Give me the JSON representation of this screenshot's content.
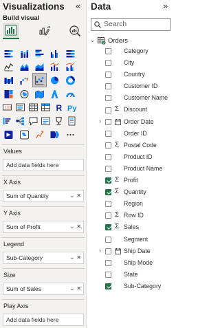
{
  "visualizations": {
    "title": "Visualizations",
    "collapse_glyph": "«",
    "build_label": "Build visual",
    "modes": [
      {
        "icon": "build-visual-icon",
        "active": true
      },
      {
        "icon": "format-visual-icon",
        "active": false
      },
      {
        "icon": "analytics-icon",
        "active": false
      }
    ],
    "gallery": [
      [
        "stacked-bar-chart-icon",
        "stacked-column-chart-icon",
        "clustered-bar-chart-icon",
        "clustered-column-chart-icon",
        "100-stacked-bar-chart-icon"
      ],
      [
        "line-chart-icon",
        "area-chart-icon",
        "stacked-area-chart-icon",
        "line-and-column-chart-icon",
        "line-and-clustered-column-chart-icon"
      ],
      [
        "ribbon-chart-icon",
        "waterfall-chart-icon",
        "scatter-chart-icon",
        "pie-chart-icon",
        "donut-chart-icon"
      ],
      [
        "treemap-icon",
        "map-icon",
        "filled-map-icon",
        "azure-map-icon",
        "gauge-icon"
      ],
      [
        "card-icon",
        "multi-row-card-icon",
        "table-icon",
        "matrix-icon",
        "r-visual-icon",
        "python-visual-icon"
      ],
      [
        "key-influencers-icon",
        "decomposition-tree-icon",
        "qa-icon",
        "smart-narrative-icon",
        "goals-icon",
        "paginated-report-icon"
      ],
      [
        "power-apps-icon",
        "power-automate-icon",
        "kpi-icon",
        "slicer-icon",
        "more-visuals-icon"
      ]
    ],
    "selected_visual": "scatter-chart-icon",
    "wells": [
      {
        "label": "Values",
        "value": "",
        "placeholder": "Add data fields here"
      },
      {
        "label": "X Axis",
        "value": "Sum of Quantity",
        "placeholder": ""
      },
      {
        "label": "Y Axis",
        "value": "Sum of Profit",
        "placeholder": ""
      },
      {
        "label": "Legend",
        "value": "Sub-Category",
        "placeholder": ""
      },
      {
        "label": "Size",
        "value": "Sum of Sales",
        "placeholder": ""
      },
      {
        "label": "Play Axis",
        "value": "",
        "placeholder": "Add data fields here"
      }
    ]
  },
  "data": {
    "title": "Data",
    "collapse_glyph": "»",
    "search_placeholder": "Search",
    "table": {
      "name": "Orders",
      "fields": [
        {
          "name": "Category",
          "sigma": false,
          "date": false,
          "expandable": false,
          "checked": false
        },
        {
          "name": "City",
          "sigma": false,
          "date": false,
          "expandable": false,
          "checked": false
        },
        {
          "name": "Country",
          "sigma": false,
          "date": false,
          "expandable": false,
          "checked": false
        },
        {
          "name": "Customer ID",
          "sigma": false,
          "date": false,
          "expandable": false,
          "checked": false
        },
        {
          "name": "Customer Name",
          "sigma": false,
          "date": false,
          "expandable": false,
          "checked": false
        },
        {
          "name": "Discount",
          "sigma": true,
          "date": false,
          "expandable": false,
          "checked": false
        },
        {
          "name": "Order Date",
          "sigma": false,
          "date": true,
          "expandable": true,
          "checked": false
        },
        {
          "name": "Order ID",
          "sigma": false,
          "date": false,
          "expandable": false,
          "checked": false
        },
        {
          "name": "Postal Code",
          "sigma": true,
          "date": false,
          "expandable": false,
          "checked": false
        },
        {
          "name": "Product ID",
          "sigma": false,
          "date": false,
          "expandable": false,
          "checked": false
        },
        {
          "name": "Product Name",
          "sigma": false,
          "date": false,
          "expandable": false,
          "checked": false
        },
        {
          "name": "Profit",
          "sigma": true,
          "date": false,
          "expandable": false,
          "checked": true
        },
        {
          "name": "Quantity",
          "sigma": true,
          "date": false,
          "expandable": false,
          "checked": true
        },
        {
          "name": "Region",
          "sigma": false,
          "date": false,
          "expandable": false,
          "checked": false
        },
        {
          "name": "Row ID",
          "sigma": true,
          "date": false,
          "expandable": false,
          "checked": false
        },
        {
          "name": "Sales",
          "sigma": true,
          "date": false,
          "expandable": false,
          "checked": true
        },
        {
          "name": "Segment",
          "sigma": false,
          "date": false,
          "expandable": false,
          "checked": false
        },
        {
          "name": "Ship Date",
          "sigma": false,
          "date": true,
          "expandable": true,
          "checked": false
        },
        {
          "name": "Ship Mode",
          "sigma": false,
          "date": false,
          "expandable": false,
          "checked": false
        },
        {
          "name": "State",
          "sigma": false,
          "date": false,
          "expandable": false,
          "checked": false
        },
        {
          "name": "Sub-Category",
          "sigma": false,
          "date": false,
          "expandable": false,
          "checked": true
        }
      ]
    }
  },
  "colors": {
    "accent": "#217346",
    "pane_bg": "#f3f2f1",
    "border": "#d2d0ce"
  }
}
